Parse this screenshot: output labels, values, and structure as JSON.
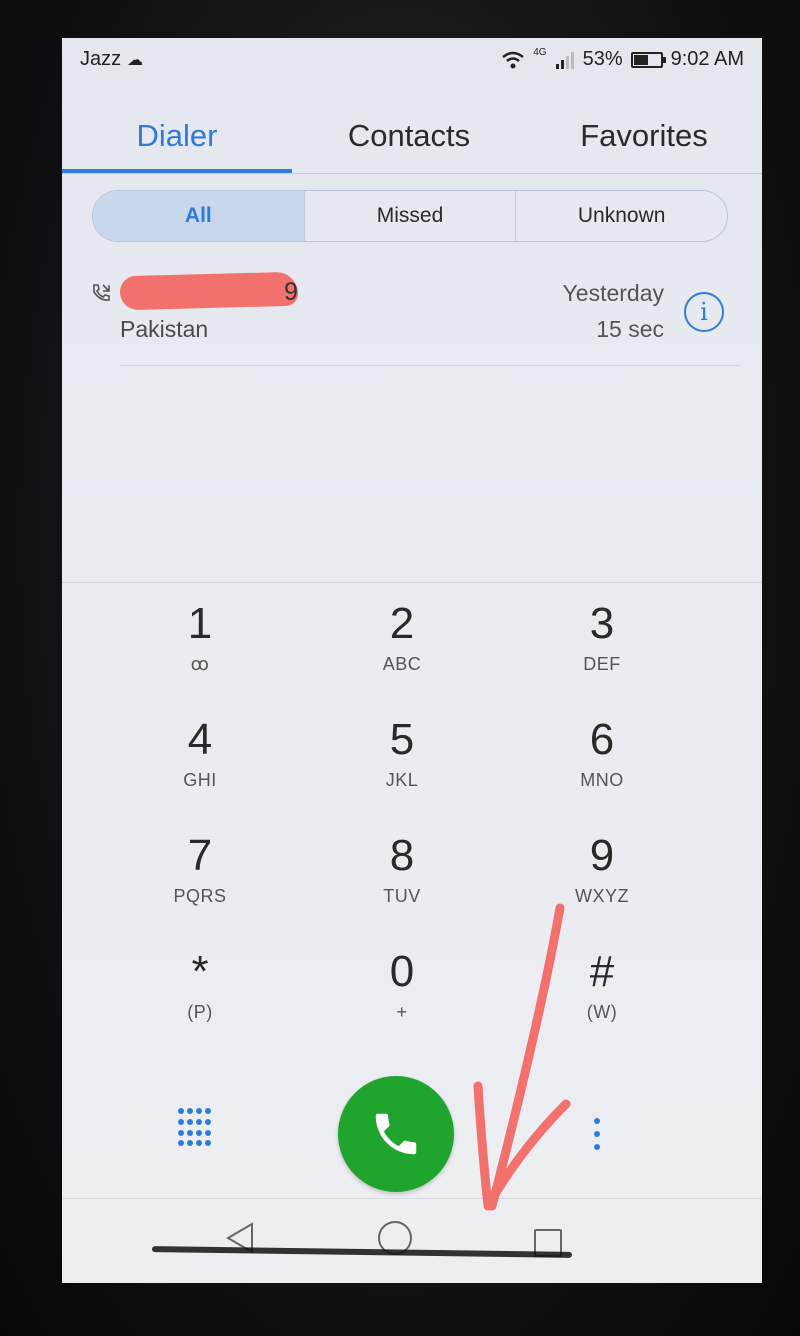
{
  "status_bar": {
    "carrier": "Jazz",
    "network": "4G",
    "battery": "53%",
    "battery_level": 0.53,
    "time": "9:02 AM"
  },
  "tabs": [
    {
      "label": "Dialer",
      "active": true
    },
    {
      "label": "Contacts",
      "active": false
    },
    {
      "label": "Favorites",
      "active": false
    }
  ],
  "filters": [
    {
      "label": "All",
      "active": true
    },
    {
      "label": "Missed",
      "active": false
    },
    {
      "label": "Unknown",
      "active": false
    }
  ],
  "call_log": [
    {
      "number_visible": "9",
      "location": "Pakistan",
      "date": "Yesterday",
      "duration": "15 sec"
    }
  ],
  "dialpad": [
    {
      "digit": "1",
      "letters": "ꝏ"
    },
    {
      "digit": "2",
      "letters": "ABC"
    },
    {
      "digit": "3",
      "letters": "DEF"
    },
    {
      "digit": "4",
      "letters": "GHI"
    },
    {
      "digit": "5",
      "letters": "JKL"
    },
    {
      "digit": "6",
      "letters": "MNO"
    },
    {
      "digit": "7",
      "letters": "PQRS"
    },
    {
      "digit": "8",
      "letters": "TUV"
    },
    {
      "digit": "9",
      "letters": "WXYZ"
    },
    {
      "digit": "*",
      "letters": "(P)"
    },
    {
      "digit": "0",
      "letters": "+"
    },
    {
      "digit": "#",
      "letters": "(W)"
    }
  ],
  "colors": {
    "accent": "#2f7bd6",
    "call_button": "#1fa52e",
    "annotation": "#f2716c"
  },
  "icons": {
    "info": "info-icon",
    "call": "phone-icon",
    "keypad": "dialpad-grid-icon",
    "more": "more-vertical-icon"
  }
}
